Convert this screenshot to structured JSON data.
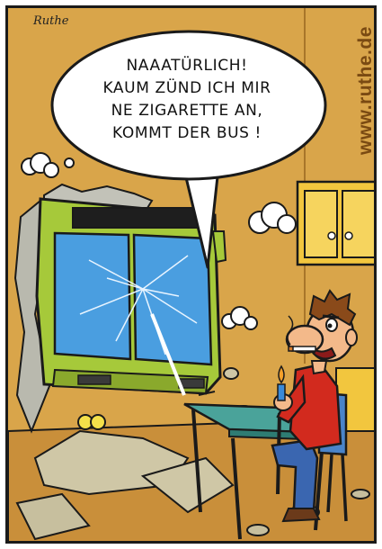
{
  "comic": {
    "speech": "NAAATÜRLICH!\nKAUM ZÜND ICH MIR\nNE ZIGARETTE AN,\nKOMMT DER BUS !",
    "signature": "Ruthe",
    "website": "www.ruthe.de"
  },
  "colors": {
    "wall": "#d9a54a",
    "floor": "#c98f3a",
    "bus": "#a6c93a",
    "shirt": "#d22a1e",
    "table": "#4aa39a",
    "cabinet": "#f2c63e"
  },
  "icons": [
    "lighter-icon",
    "cigarette-icon",
    "smoke-puff-icon"
  ]
}
